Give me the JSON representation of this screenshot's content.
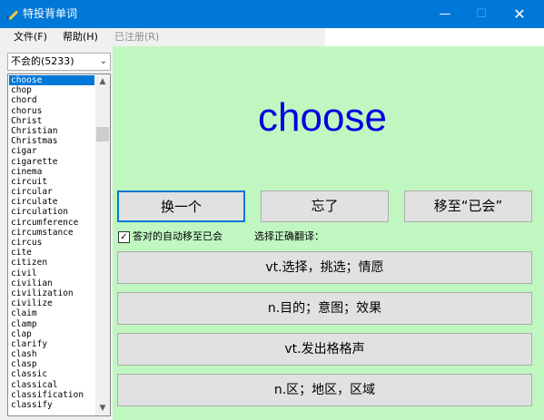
{
  "window": {
    "title": "特投背单词",
    "minimize": "—",
    "maximize": "☐",
    "close": "✕"
  },
  "menu": {
    "file": "文件(F)",
    "help": "帮助(H)",
    "registered": "已注册(R)"
  },
  "filter": {
    "selected": "不会的(5233)"
  },
  "word_list": [
    "choose",
    "chop",
    "chord",
    "chorus",
    "Christ",
    "Christian",
    "Christmas",
    "cigar",
    "cigarette",
    "cinema",
    "circuit",
    "circular",
    "circulate",
    "circulation",
    "circumference",
    "circumstance",
    "circus",
    "cite",
    "citizen",
    "civil",
    "civilian",
    "civilization",
    "civilize",
    "claim",
    "clamp",
    "clap",
    "clarify",
    "clash",
    "clasp",
    "classic",
    "classical",
    "classification",
    "classify"
  ],
  "selected_index": 0,
  "current_word": "choose",
  "buttons": {
    "next": "换一个",
    "forgot": "忘了",
    "move_known": "移至“已会”"
  },
  "auto_move": {
    "checked": true,
    "label": "答对的自动移至已会"
  },
  "prompt": "选择正确翻译：",
  "answers": [
    "vt.选择，挑选；情愿",
    "n.目的；意图；效果",
    "vt.发出格格声",
    "n.区；地区，区域"
  ]
}
